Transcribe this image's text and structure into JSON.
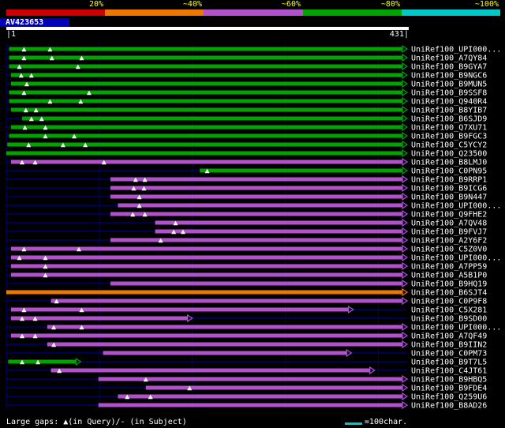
{
  "scale": {
    "segments": [
      {
        "label": "20%",
        "color": "#cc0000"
      },
      {
        "label": "~40%",
        "color": "#ee7700"
      },
      {
        "label": "~60%",
        "color": "#b152cc"
      },
      {
        "label": "~80%",
        "color": "#00a300"
      },
      {
        "label": "~100%",
        "color": "#00c8c8"
      }
    ]
  },
  "query": {
    "name": "AV423653",
    "length": 431,
    "start_tick": "|1",
    "end_tick": "431|"
  },
  "footer": {
    "gaps_text": "Large gaps: ▲(in Query)/- (in Subject)",
    "scale_text": "=100char."
  },
  "colors": {
    "green": "#00a300",
    "purple": "#b152cc",
    "orange": "#ee7700",
    "cyan": "#00c8c8",
    "baseline": "#000070",
    "grid": "#000070",
    "gap_marker": "#ffffff",
    "label_text": "#ffffff"
  },
  "chart_data": {
    "type": "bar",
    "orientation": "horizontal",
    "x_range": [
      1,
      431
    ],
    "gridlines": [
      0,
      100,
      200,
      300,
      400
    ],
    "identity_by_color": {
      "green": "~80%",
      "purple": "~60%",
      "orange": "~40%"
    },
    "rows": [
      {
        "label": "UniRef100_UPI000...",
        "color": "green",
        "start": 3,
        "end": 431,
        "query_gaps": [
          19,
          47
        ]
      },
      {
        "label": "UniRef100_A7QY84",
        "color": "green",
        "start": 3,
        "end": 431,
        "query_gaps": [
          19,
          49,
          81
        ]
      },
      {
        "label": "UniRef100_B9GYA7",
        "color": "green",
        "start": 3,
        "end": 431,
        "query_gaps": [
          14,
          77
        ]
      },
      {
        "label": "UniRef100_B9NGC6",
        "color": "green",
        "start": 5,
        "end": 431,
        "query_gaps": [
          16,
          27
        ]
      },
      {
        "label": "UniRef100_B9MUN5",
        "color": "green",
        "start": 5,
        "end": 431,
        "query_gaps": [
          22
        ]
      },
      {
        "label": "UniRef100_B9SSF8",
        "color": "green",
        "start": 3,
        "end": 431,
        "query_gaps": [
          19,
          89
        ]
      },
      {
        "label": "UniRef100_Q940R4",
        "color": "green",
        "start": 3,
        "end": 431,
        "query_gaps": [
          47,
          80
        ]
      },
      {
        "label": "UniRef100_B8YIB7",
        "color": "green",
        "start": 5,
        "end": 431,
        "query_gaps": [
          21,
          32
        ]
      },
      {
        "label": "UniRef100_B6SJD9",
        "color": "green",
        "start": 17,
        "end": 431,
        "query_gaps": [
          27,
          38
        ]
      },
      {
        "label": "UniRef100_Q7XU71",
        "color": "green",
        "start": 5,
        "end": 431,
        "query_gaps": [
          20,
          42
        ]
      },
      {
        "label": "UniRef100_B9FGC3",
        "color": "green",
        "start": 3,
        "end": 431,
        "query_gaps": [
          42,
          73
        ]
      },
      {
        "label": "UniRef100_C5YCY2",
        "color": "green",
        "start": 1,
        "end": 431,
        "query_gaps": [
          24,
          61,
          85
        ]
      },
      {
        "label": "UniRef100_Q23500",
        "color": "green",
        "start": 0,
        "end": 431,
        "query_gaps": []
      },
      {
        "label": "UniRef100_B8LMJ0",
        "color": "purple",
        "start": 5,
        "end": 431,
        "query_gaps": [
          17,
          31,
          105
        ]
      },
      {
        "label": "UniRef100_C0PN95",
        "color": "green",
        "start": 208,
        "end": 431,
        "query_gaps": [
          216
        ]
      },
      {
        "label": "UniRef100_B9RRP1",
        "color": "purple",
        "start": 112,
        "end": 431,
        "query_gaps": [
          139,
          149
        ]
      },
      {
        "label": "UniRef100_B9ICG6",
        "color": "purple",
        "start": 112,
        "end": 431,
        "query_gaps": [
          137,
          148
        ]
      },
      {
        "label": "UniRef100_B9N447",
        "color": "purple",
        "start": 112,
        "end": 431,
        "query_gaps": [
          143
        ]
      },
      {
        "label": "UniRef100_UPI000...",
        "color": "purple",
        "start": 120,
        "end": 431,
        "query_gaps": [
          143
        ]
      },
      {
        "label": "UniRef100_Q9FHE2",
        "color": "purple",
        "start": 112,
        "end": 431,
        "query_gaps": [
          136,
          149
        ]
      },
      {
        "label": "UniRef100_A7QV48",
        "color": "purple",
        "start": 160,
        "end": 431,
        "query_gaps": [
          182
        ]
      },
      {
        "label": "UniRef100_B9FVJ7",
        "color": "purple",
        "start": 160,
        "end": 431,
        "query_gaps": [
          180,
          190
        ]
      },
      {
        "label": "UniRef100_A2Y6F2",
        "color": "purple",
        "start": 112,
        "end": 431,
        "query_gaps": [
          166
        ]
      },
      {
        "label": "UniRef100_C5Z0V0",
        "color": "purple",
        "start": 5,
        "end": 431,
        "query_gaps": [
          19,
          78
        ]
      },
      {
        "label": "UniRef100_UPI000...",
        "color": "purple",
        "start": 5,
        "end": 431,
        "query_gaps": [
          14,
          42
        ]
      },
      {
        "label": "UniRef100_A7PP59",
        "color": "purple",
        "start": 5,
        "end": 431,
        "query_gaps": [
          42
        ]
      },
      {
        "label": "UniRef100_A5B1P0",
        "color": "purple",
        "start": 5,
        "end": 431,
        "query_gaps": [
          42
        ]
      },
      {
        "label": "UniRef100_B9HQ19",
        "color": "purple",
        "start": 112,
        "end": 431,
        "query_gaps": []
      },
      {
        "label": "UniRef100_B6SJT4",
        "color": "orange",
        "start": 0,
        "end": 431,
        "query_gaps": []
      },
      {
        "label": "UniRef100_C0P9F8",
        "color": "purple",
        "start": 48,
        "end": 431,
        "query_gaps": [
          54
        ]
      },
      {
        "label": "UniRef100_C5X281",
        "color": "purple",
        "start": 5,
        "end": 373,
        "query_gaps": [
          19,
          81
        ]
      },
      {
        "label": "UniRef100_B9SD00",
        "color": "purple",
        "start": 5,
        "end": 200,
        "query_gaps": [
          17,
          31
        ]
      },
      {
        "label": "UniRef100_UPI000...",
        "color": "purple",
        "start": 44,
        "end": 431,
        "query_gaps": [
          51,
          81
        ]
      },
      {
        "label": "UniRef100_A7QF49",
        "color": "purple",
        "start": 5,
        "end": 431,
        "query_gaps": [
          17,
          31
        ]
      },
      {
        "label": "UniRef100_B9IIN2",
        "color": "purple",
        "start": 44,
        "end": 431,
        "query_gaps": [
          51
        ]
      },
      {
        "label": "UniRef100_C0PM73",
        "color": "purple",
        "start": 104,
        "end": 371,
        "query_gaps": []
      },
      {
        "label": "UniRef100_B9T7L5",
        "color": "green",
        "start": 2,
        "end": 80,
        "query_gaps": [
          17,
          34
        ]
      },
      {
        "label": "UniRef100_C4JT61",
        "color": "purple",
        "start": 48,
        "end": 396,
        "query_gaps": [
          57
        ]
      },
      {
        "label": "UniRef100_B9HBQ5",
        "color": "purple",
        "start": 99,
        "end": 431,
        "query_gaps": [
          150
        ]
      },
      {
        "label": "UniRef100_B9FDE4",
        "color": "purple",
        "start": 150,
        "end": 431,
        "query_gaps": [
          197
        ]
      },
      {
        "label": "UniRef100_Q259U6",
        "color": "purple",
        "start": 120,
        "end": 431,
        "query_gaps": [
          130,
          155
        ]
      },
      {
        "label": "UniRef100_B8AD26",
        "color": "purple",
        "start": 99,
        "end": 431,
        "query_gaps": []
      }
    ]
  }
}
